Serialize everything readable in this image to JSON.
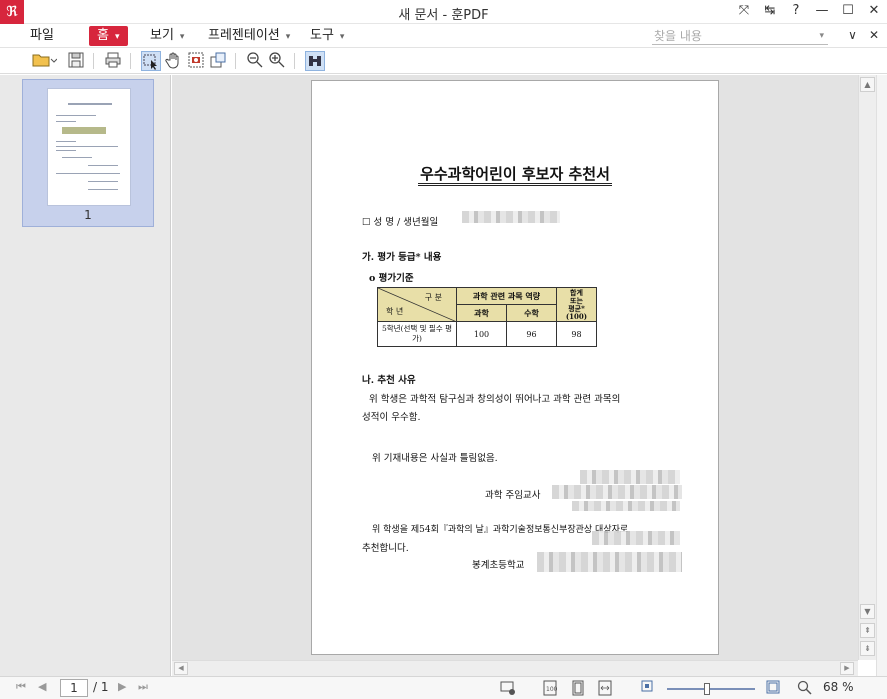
{
  "window": {
    "title": "새 문서 - 훈PDF",
    "logo_glyph": "ℜ",
    "controls": [
      "⤧",
      "↹",
      "?",
      "—",
      "☐",
      "✕"
    ]
  },
  "menu": {
    "file": "파일",
    "home": "홈",
    "view": "보기",
    "presentation": "프레젠테이션",
    "tools": "도구",
    "caret": "▾",
    "search_placeholder": "찾을 내용",
    "search_caret": "▾",
    "right": [
      "∨",
      "✕"
    ]
  },
  "toolbar": {
    "icons": [
      "folder-open-icon",
      "save-icon",
      "print-icon",
      "select-icon",
      "hand-icon",
      "snapshot-icon",
      "rotate-icon",
      "zoom-out-icon",
      "zoom-in-icon",
      "find-icon"
    ]
  },
  "thumbnail": {
    "page_label": "1"
  },
  "document": {
    "title": "우수과학어린이 후보자 추천서",
    "name_line": "☐ 성 명 / 생년월일",
    "section_a": "가. 평가 등급* 내용",
    "criteria": "o 평가기준",
    "table": {
      "header_split": "구 분",
      "header_grade": "학 년",
      "header_ability": "과학 관련 과목 역량",
      "header_total": "합계\n또는\n평균*\n(100)",
      "col_science": "과학",
      "col_math": "수학",
      "row_label": "5학년(선택 및 필수 평가)",
      "science": "100",
      "math": "96",
      "total": "98"
    },
    "section_b": "나. 추천 사유",
    "reason_1": "위 학생은 과학적 탐구심과 창의성이 뛰어나고 과학 관련 과목의",
    "reason_2": "성적이 우수함.",
    "confirm": "위 기재내용은 사실과 틀림없음.",
    "teacher": "과학 주임교사",
    "recommend_1": "위 학생을 제54회『과학의 날』과학기술정보통신부장관상 대상자로",
    "recommend_2": "추천합니다.",
    "school": "봉계초등학교"
  },
  "statusbar": {
    "page_current": "1",
    "page_total": "/ 1",
    "zoom": "68 %",
    "zoom_fraction": 0.42
  }
}
